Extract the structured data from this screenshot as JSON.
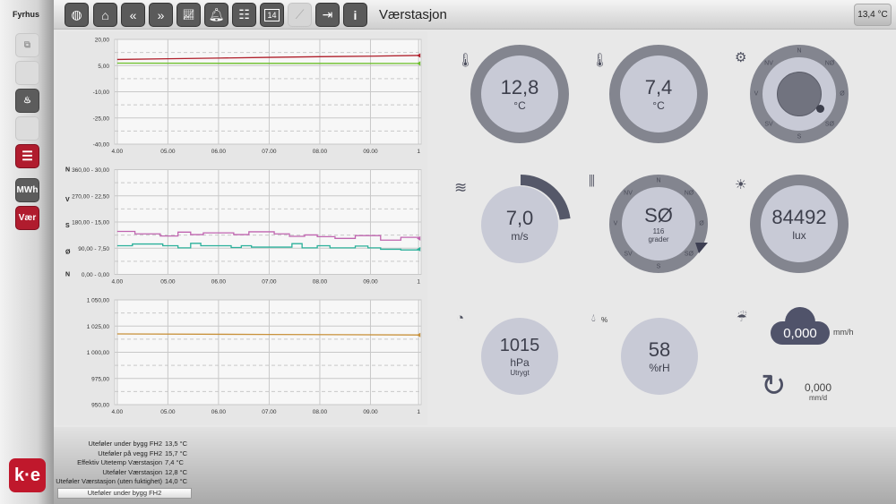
{
  "sidebar": {
    "brand": "Fyrhus",
    "buttons": [
      "",
      "",
      "",
      "",
      "",
      "MWh",
      "Vær"
    ],
    "logo": "ke"
  },
  "topbar": {
    "title": "Værstasjon",
    "temp_badge": "13,4 °C",
    "icons": [
      "globe-icon",
      "home-icon",
      "rewind-icon",
      "forward-icon",
      "chart-icon",
      "bell-icon",
      "calendar-list-icon",
      "calendar-14-icon",
      "curve-icon",
      "login-icon",
      "info-icon"
    ],
    "calendar_day": "14"
  },
  "chart_data": [
    {
      "type": "line",
      "ylim": [
        -40,
        20
      ],
      "yticks": [
        "20,00",
        "5,00",
        "-10,00",
        "-25,00",
        "-40,00"
      ],
      "xticks": [
        "4.00",
        "05.00",
        "06.00",
        "07.00",
        "08.00",
        "09.00",
        "1"
      ],
      "series": [
        {
          "name": "red",
          "color": "#b0202c",
          "x": [
            4,
            5,
            6,
            7,
            8,
            9,
            9.95
          ],
          "y": [
            8.5,
            8.9,
            9.3,
            9.7,
            10.1,
            10.4,
            10.8
          ]
        },
        {
          "name": "green",
          "color": "#6cbf2a",
          "x": [
            4,
            9.95
          ],
          "y": [
            6.4,
            6.2
          ]
        }
      ]
    },
    {
      "type": "line",
      "ylim": [
        0,
        30
      ],
      "yticks": [
        "360,00  -  30,00",
        "270,00  -  22,50",
        "180,00  -  15,00",
        "90,00  -  7,50",
        "0,00  -  0,00"
      ],
      "ylabels_dir": [
        "N",
        "V",
        "S",
        "Ø",
        "N"
      ],
      "xticks": [
        "4.00",
        "05.00",
        "06.00",
        "07.00",
        "08.00",
        "09.00",
        "1"
      ],
      "series": [
        {
          "name": "direction",
          "color": "#c065b0",
          "x": [
            4,
            4.35,
            4.85,
            5.2,
            5.45,
            5.7,
            6.3,
            6.6,
            7.1,
            7.4,
            7.7,
            7.95,
            8.3,
            8.7,
            9.2,
            9.6,
            9.95
          ],
          "y": [
            12.3,
            11.6,
            11,
            12.1,
            11.4,
            11.9,
            11.4,
            12.2,
            11.6,
            10.9,
            11.3,
            10.8,
            10.3,
            11.1,
            9.8,
            10.6,
            10.3
          ]
        },
        {
          "name": "speed",
          "color": "#2bb09a",
          "x": [
            4,
            4.3,
            4.9,
            5.2,
            5.45,
            5.65,
            6.25,
            6.45,
            6.65,
            7.45,
            7.65,
            7.95,
            8.2,
            8.7,
            8.95,
            9.2,
            9.6,
            9.95
          ],
          "y": [
            8.2,
            8.7,
            8.2,
            7.6,
            8.9,
            8.2,
            7.7,
            8.2,
            7.8,
            8.8,
            7.6,
            8.2,
            7.6,
            8.1,
            7.6,
            7.2,
            7,
            7.2
          ]
        }
      ]
    },
    {
      "type": "line",
      "ylim": [
        950,
        1050
      ],
      "yticks": [
        "1 050,00",
        "1 025,00",
        "1 000,00",
        "975,00",
        "950,00"
      ],
      "xticks": [
        "4.00",
        "05.00",
        "06.00",
        "07.00",
        "08.00",
        "09.00",
        "1"
      ],
      "series": [
        {
          "name": "pressure",
          "color": "#c8913a",
          "x": [
            4,
            7,
            9.95
          ],
          "y": [
            1017.5,
            1017,
            1016.5
          ]
        }
      ]
    }
  ],
  "gauges": {
    "temp": {
      "value": "12,8",
      "unit": "°C"
    },
    "eff_temp": {
      "value": "7,4",
      "unit": "°C"
    },
    "sun": {
      "dirs": [
        "N",
        "NØ",
        "Ø",
        "SØ",
        "S",
        "SV",
        "V",
        "NV"
      ]
    },
    "wind_speed": {
      "value": "7,0",
      "unit": "m/s",
      "fraction": 0.23
    },
    "wind_dir": {
      "value": "SØ",
      "deg": "116",
      "unit": "grader",
      "dirs": [
        "N",
        "NØ",
        "Ø",
        "SØ",
        "S",
        "SV",
        "V",
        "NV"
      ]
    },
    "lux": {
      "value": "84492",
      "unit": "lux"
    },
    "pressure": {
      "value": "1015",
      "unit": "hPa",
      "status": "Utrygt"
    },
    "humidity": {
      "value": "58",
      "unit": "%rH",
      "icon_label": "%"
    },
    "rain": {
      "value": "0,000",
      "unit": "mm/h",
      "daily": "0,000",
      "daily_unit": "mm/d"
    }
  },
  "bottom": {
    "rows": [
      {
        "label": "Uteføler under bygg FH2",
        "value": "13,5 °C"
      },
      {
        "label": "Uteføler på vegg FH2",
        "value": "15,7 °C"
      },
      {
        "label": "Effektiv Utetemp Værstasjon",
        "value": "7,4 °C"
      },
      {
        "label": "Uteføler Værstasjon",
        "value": "12,8 °C"
      },
      {
        "label": "Uteføler Værstasjon (uten fuktighet)",
        "value": "14,0 °C"
      }
    ],
    "selected": "Uteføler under bygg FH2"
  }
}
